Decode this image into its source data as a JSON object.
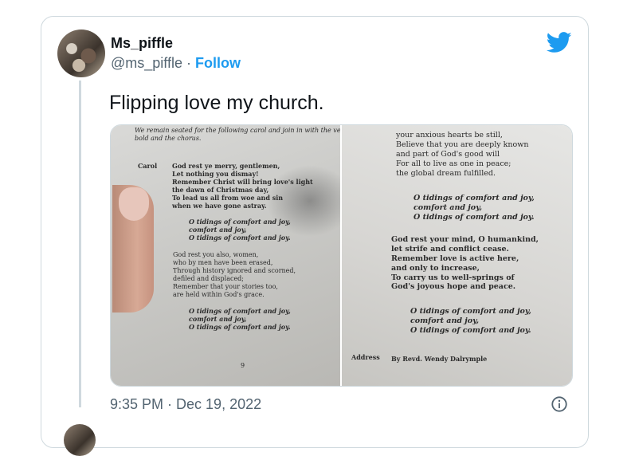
{
  "tweet": {
    "display_name": "Ms_piffle",
    "handle": "@ms_piffle",
    "separator": "·",
    "follow_label": "Follow",
    "text": "Flipping love my church.",
    "timestamp": "9:35 PM · Dec 19, 2022",
    "brand_color": "#1d9bf0"
  },
  "photo_left": {
    "intro": "We remain seated for the following carol and join in with the verses in\nbold and the chorus.",
    "label": "Carol",
    "verse1": "God rest ye merry, gentlemen,\nLet nothing you dismay!\nRemember Christ will bring love's light\nthe dawn of Christmas day,\nTo lead us all from woe and sin\nwhen we have gone astray.",
    "chorus1": "O tidings of comfort and joy,\ncomfort and joy,\nO tidings of comfort and joy.",
    "verse2": "God rest you also, women,\nwho by men have been erased,\nThrough history ignored and scorned,\ndefiled and displaced;\nRemember that your stories too,\nare held within God's grace.",
    "chorus2": "O tidings of comfort and joy,\ncomfort and joy,\nO tidings of comfort and joy.",
    "page_number": "9"
  },
  "photo_right": {
    "verse_top": "your anxious hearts be still,\nBelieve that you are deeply known\nand part of God's good will\nFor all to live as one in peace;\nthe global dream fulfilled.",
    "chorus1": "O tidings of comfort and joy,\ncomfort and joy,\nO tidings of comfort and joy.",
    "verse3": "God rest your mind, O humankind,\nlet strife and conflict cease.\nRemember love is active here,\nand only to increase,\nTo carry us to well-springs of\nGod's joyous hope and peace.",
    "chorus2": "O tidings of comfort and joy,\ncomfort and joy,\nO tidings of comfort and joy.",
    "address_label": "Address",
    "address_text": "By Revd. Wendy Dalrymple"
  }
}
